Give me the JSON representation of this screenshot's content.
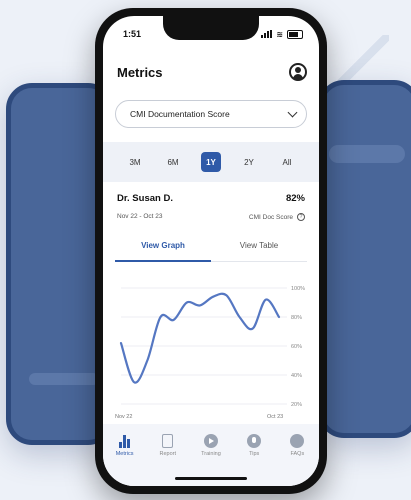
{
  "status": {
    "time": "1:51"
  },
  "header": {
    "title": "Metrics",
    "profile_icon": "user-circle-icon"
  },
  "metric_select": {
    "value": "CMI Documentation Score"
  },
  "ranges": [
    {
      "label": "3M",
      "active": false
    },
    {
      "label": "6M",
      "active": false
    },
    {
      "label": "1Y",
      "active": true
    },
    {
      "label": "2Y",
      "active": false
    },
    {
      "label": "All",
      "active": false
    }
  ],
  "card": {
    "name": "Dr. Susan D.",
    "score": "82%",
    "date_range": "Nov 22 - Oct 23",
    "metric_label": "CMI Doc Score"
  },
  "tabs": {
    "graph": "View Graph",
    "table": "View Table"
  },
  "chart_data": {
    "type": "line",
    "x_start_label": "Nov 22",
    "x_end_label": "Oct 23",
    "yticks": [
      "100%",
      "80%",
      "60%",
      "40%",
      "20%"
    ],
    "ylim": [
      20,
      100
    ],
    "values": [
      62,
      35,
      50,
      80,
      78,
      90,
      88,
      94,
      95,
      80,
      72,
      92,
      80
    ],
    "color": "#5577c2",
    "grid": true
  },
  "tabbar": [
    {
      "label": "Metrics",
      "icon": "bar-chart-icon",
      "active": true
    },
    {
      "label": "Report",
      "icon": "document-icon",
      "active": false
    },
    {
      "label": "Training",
      "icon": "play-icon",
      "active": false
    },
    {
      "label": "Tips",
      "icon": "lightbulb-icon",
      "active": false
    },
    {
      "label": "FAQs",
      "icon": "question-icon",
      "active": false
    }
  ],
  "colors": {
    "accent": "#2f5aa8",
    "background": "#edf1f8"
  }
}
